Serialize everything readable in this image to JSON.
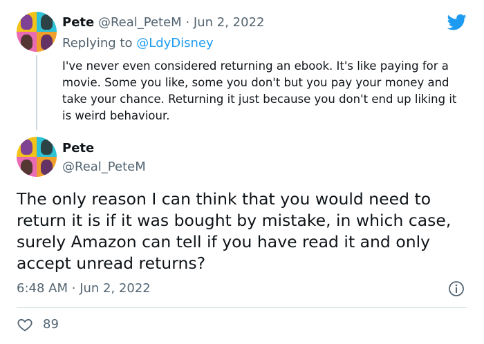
{
  "reply_tweet": {
    "name": "Pete",
    "handle": "@Real_PeteM",
    "separator": "·",
    "date": "Jun 2, 2022",
    "replying_prefix": "Replying to ",
    "replying_handle": "@LdyDisney",
    "text": "I've never even considered returning an ebook. It's like paying for a movie. Some you like, some you don't but you pay your money and take your chance. Returning it just because you don't end up liking it is weird behaviour."
  },
  "main_tweet": {
    "name": "Pete",
    "handle": "@Real_PeteM",
    "text": "The only reason I can think that you would need to return it is if it was bought by mistake, in which case, surely Amazon can tell if you have read it and only accept unread returns?",
    "time": "6:48 AM",
    "separator": "·",
    "date": "Jun 2, 2022",
    "likes": "89"
  },
  "icons": {
    "logo": "twitter-bird-icon",
    "info": "info-icon",
    "like": "heart-icon"
  },
  "colors": {
    "brand": "#1d9bf0",
    "text": "#0f1419",
    "muted": "#536471",
    "divider": "#cfd9de"
  }
}
